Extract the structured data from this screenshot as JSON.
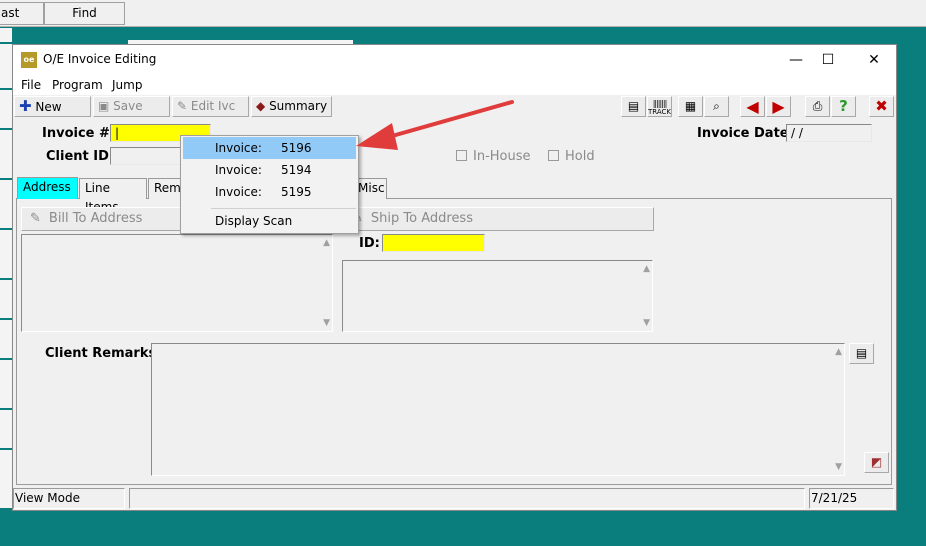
{
  "background_app": {
    "buttons": [
      "ast",
      "Find"
    ]
  },
  "window": {
    "icon_text": "oe",
    "title": "O/E Invoice Editing",
    "controls": {
      "minimize": "—",
      "maximize": "☐",
      "close": "✕"
    }
  },
  "menu": {
    "items": [
      "File",
      "Program",
      "Jump"
    ]
  },
  "toolbar": {
    "new_label": "New",
    "save_label": "Save",
    "edit_label": "Edit Ivc",
    "summary_label": "Summary",
    "track_label": "TRACK"
  },
  "form": {
    "invoice_label": "Invoice #:",
    "invoice_value": "|",
    "client_label": "Client ID:",
    "client_value": "",
    "invoice_date_label": "Invoice Date:",
    "invoice_date_value": "/ /",
    "in_house_label": "In-House",
    "hold_label": "Hold"
  },
  "tabs": [
    "Address",
    "Line Items",
    "Rema",
    "Misc"
  ],
  "address": {
    "bill_to_label": "Bill To Address",
    "ship_to_label": "Ship To Address",
    "ship_id_label": "ID:",
    "ship_id_value": "",
    "client_remarks_label": "Client Remarks:"
  },
  "status": {
    "mode": "View Mode",
    "middle": "",
    "date": "7/21/25"
  },
  "popup": {
    "items": [
      {
        "label": "Invoice:",
        "number": "5196"
      },
      {
        "label": "Invoice:",
        "number": "5194"
      },
      {
        "label": "Invoice:",
        "number": "5195"
      }
    ],
    "display_scan": "Display Scan"
  },
  "colors": {
    "desktop": "#0a7d7d",
    "field_highlight": "#ffff00",
    "active_tab": "#00ffff",
    "popup_highlight": "#91c9f7",
    "annotation_arrow": "#e03c3c"
  }
}
